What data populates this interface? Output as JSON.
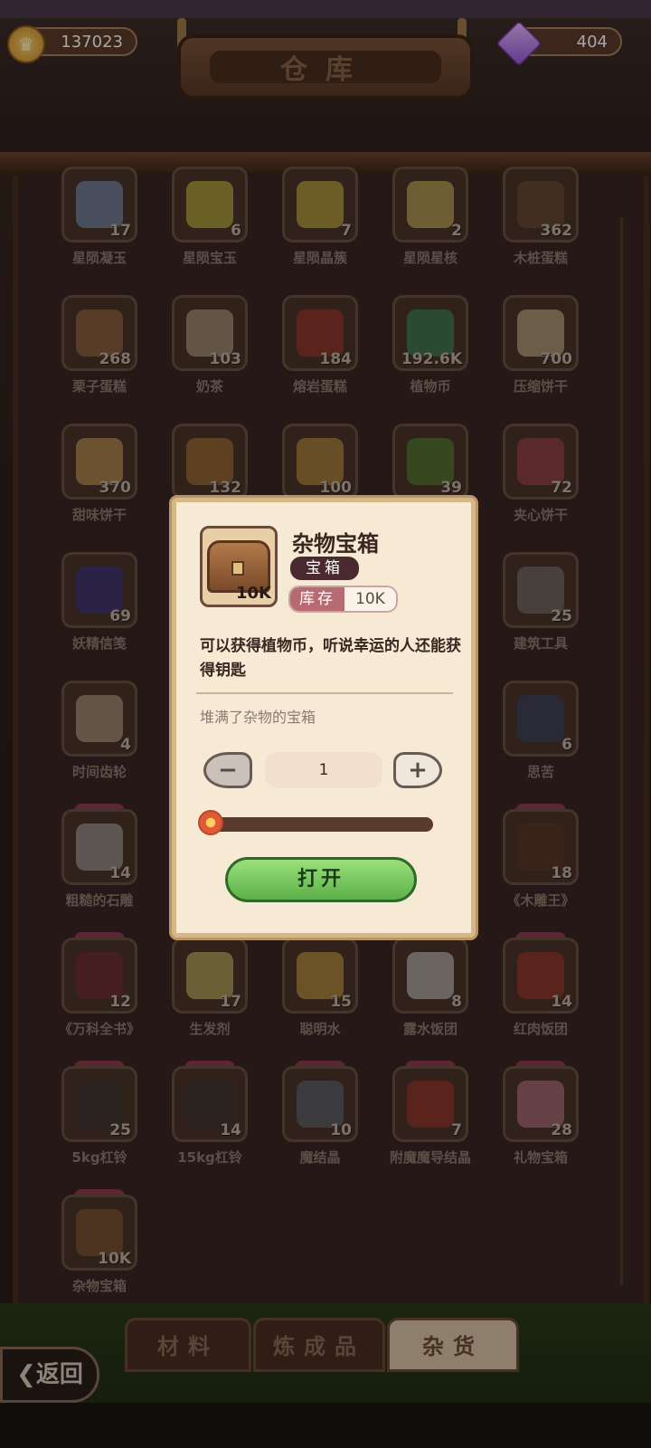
{
  "header": {
    "title": "仓库",
    "coins": "137023",
    "gems": "404"
  },
  "items": [
    {
      "name": "星陨凝玉",
      "count": "17",
      "color": "#8fb2e6"
    },
    {
      "name": "星陨宝玉",
      "count": "6",
      "color": "#f0e34a"
    },
    {
      "name": "星陨晶簇",
      "count": "7",
      "color": "#f3d94a"
    },
    {
      "name": "星陨星核",
      "count": "2",
      "color": "#f6e070"
    },
    {
      "name": "木桩蛋糕",
      "count": "362",
      "color": "#7a5a3a"
    },
    {
      "name": "栗子蛋糕",
      "count": "268",
      "color": "#b8844e"
    },
    {
      "name": "奶茶",
      "count": "103",
      "color": "#d9c9a8"
    },
    {
      "name": "熔岩蛋糕",
      "count": "184",
      "color": "#c03a30"
    },
    {
      "name": "植物币",
      "count": "192.6K",
      "color": "#3aa66a"
    },
    {
      "name": "压缩饼干",
      "count": "700",
      "color": "#f0dcaa"
    },
    {
      "name": "甜味饼干",
      "count": "370",
      "color": "#f0c06a"
    },
    {
      "name": "",
      "count": "132",
      "color": "#c98a3a"
    },
    {
      "name": "",
      "count": "100",
      "color": "#e8b04a"
    },
    {
      "name": "",
      "count": "39",
      "color": "#5aa03a"
    },
    {
      "name": "夹心饼干",
      "count": "72",
      "color": "#c04a5a"
    },
    {
      "name": "妖精信笺",
      "count": "69",
      "color": "#3a3aa0"
    },
    {
      "name": "",
      "count": "",
      "color": ""
    },
    {
      "name": "",
      "count": "",
      "color": ""
    },
    {
      "name": "",
      "count": "",
      "color": ""
    },
    {
      "name": "建筑工具",
      "count": "25",
      "color": "#8a8a8a"
    },
    {
      "name": "时间齿轮",
      "count": "4",
      "color": "#d9c9a8"
    },
    {
      "name": "",
      "count": "",
      "color": ""
    },
    {
      "name": "",
      "count": "",
      "color": ""
    },
    {
      "name": "",
      "count": "",
      "color": ""
    },
    {
      "name": "思苦",
      "count": "6",
      "color": "#3a4a7a"
    },
    {
      "name": "粗糙的石雕",
      "count": "14",
      "color": "#c8c8c8"
    },
    {
      "name": "",
      "count": "",
      "color": ""
    },
    {
      "name": "",
      "count": "",
      "color": ""
    },
    {
      "name": "",
      "count": "",
      "color": ""
    },
    {
      "name": "《木雕王》",
      "count": "18",
      "color": "#6a3a2a"
    },
    {
      "name": "《万科全书》",
      "count": "12",
      "color": "#8a2a3a"
    },
    {
      "name": "生发剂",
      "count": "17",
      "color": "#f0e07a"
    },
    {
      "name": "聪明水",
      "count": "15",
      "color": "#f0c04a"
    },
    {
      "name": "露水饭团",
      "count": "8",
      "color": "#f0f0f0"
    },
    {
      "name": "红肉饭团",
      "count": "14",
      "color": "#c03a30"
    },
    {
      "name": "5kg杠铃",
      "count": "25",
      "color": "#3a3a3a"
    },
    {
      "name": "15kg杠铃",
      "count": "14",
      "color": "#3a3a3a"
    },
    {
      "name": "魔结晶",
      "count": "10",
      "color": "#6a7a8a"
    },
    {
      "name": "附魔魔导结晶",
      "count": "7",
      "color": "#c03a30"
    },
    {
      "name": "礼物宝箱",
      "count": "28",
      "color": "#e08aa0"
    },
    {
      "name": "杂物宝箱",
      "count": "10K",
      "color": "#9a6a3a"
    }
  ],
  "popup": {
    "title": "杂物宝箱",
    "tag": "宝箱",
    "qty": "10K",
    "stock_label": "库存",
    "stock_value": "10K",
    "description": "可以获得植物币，听说幸运的人还能获得钥匙",
    "flavor": "堆满了杂物的宝箱",
    "amount": "1",
    "amount_fraction": 0.0,
    "open_label": "打开"
  },
  "tabs": [
    {
      "label": "材料",
      "active": false
    },
    {
      "label": "炼成品",
      "active": false
    },
    {
      "label": "杂货",
      "active": true
    }
  ],
  "back_label": "返回"
}
